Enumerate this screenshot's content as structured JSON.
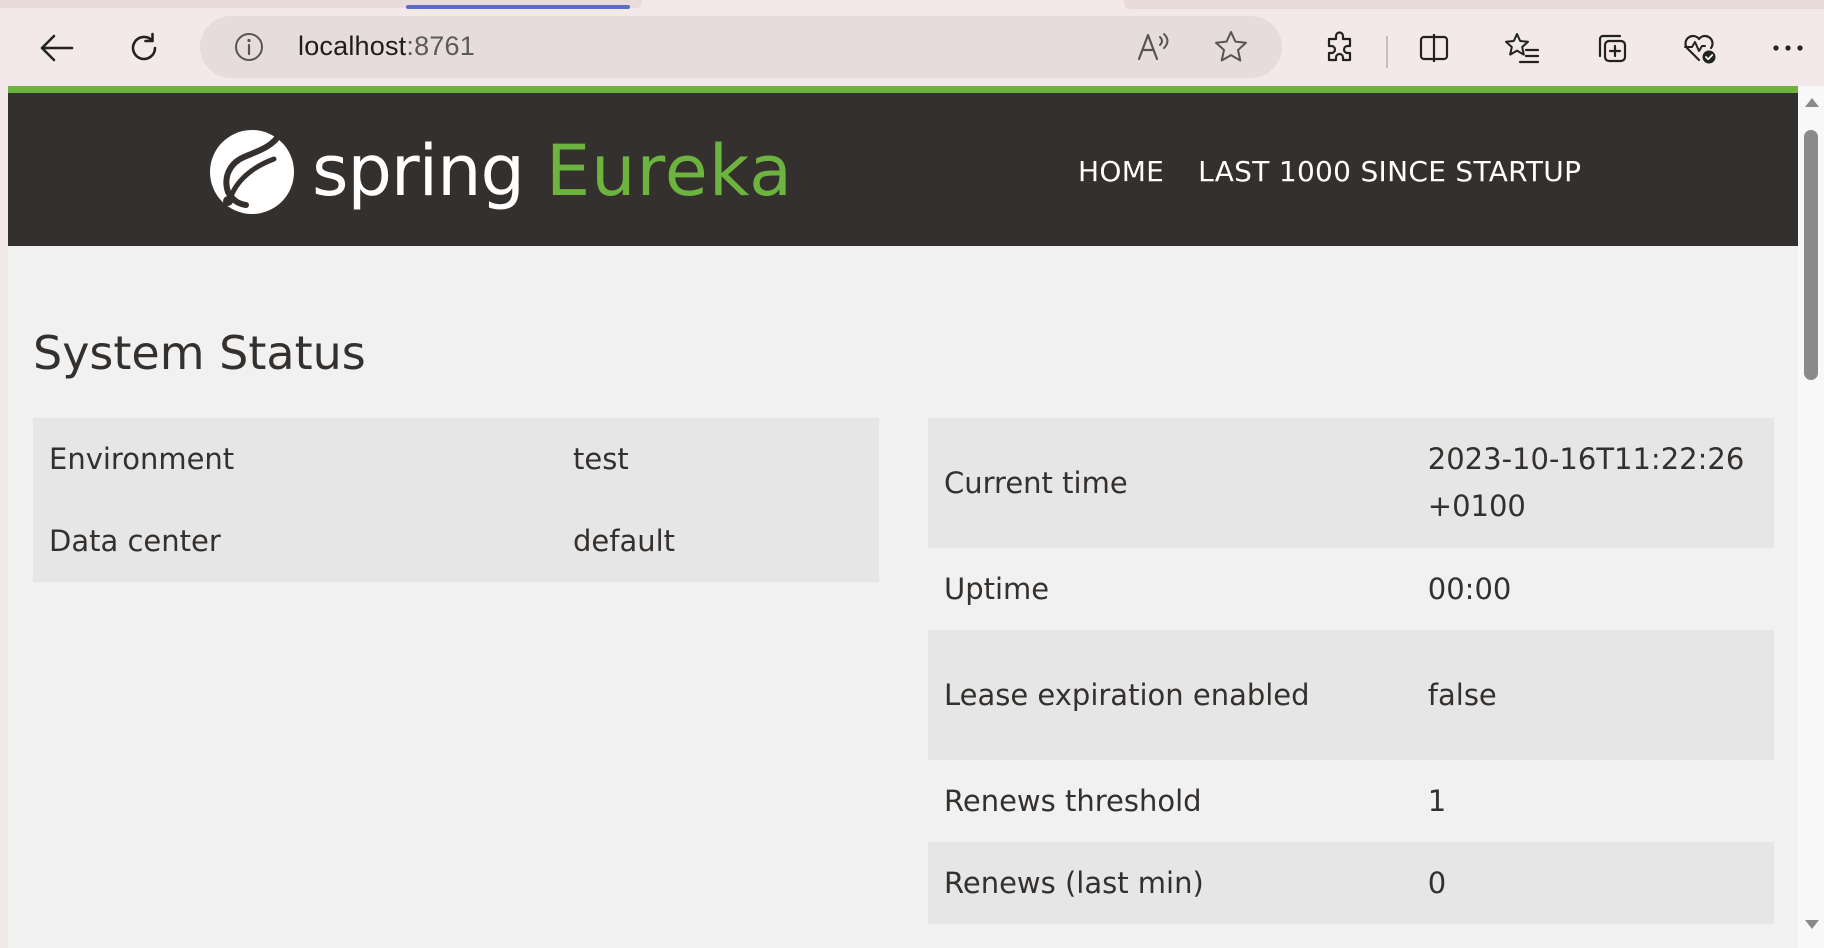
{
  "browser": {
    "address": {
      "host": "localhost",
      "port": ":8761"
    },
    "icons": {
      "back": "back-arrow-icon",
      "refresh": "refresh-icon",
      "site_info": "info-icon",
      "read_aloud": "read-aloud-icon",
      "favorite": "star-icon",
      "extensions": "puzzle-icon",
      "split_screen": "split-screen-icon",
      "favorites": "favorites-list-icon",
      "collections": "collections-icon",
      "health": "heart-pulse-icon",
      "more": "more-dots-icon"
    },
    "colors": {
      "frame": "#f3e9e8",
      "active_tab_indicator": "#5b6dc7"
    }
  },
  "header": {
    "logo_spring": "spring",
    "logo_eureka": "Eureka",
    "nav": [
      {
        "label": "HOME"
      },
      {
        "label": "LAST 1000 SINCE STARTUP"
      }
    ],
    "colors": {
      "navbar": "#34302d",
      "accent": "#6db33f"
    }
  },
  "main": {
    "title": "System Status",
    "left_table": [
      {
        "key": "Environment",
        "value": "test"
      },
      {
        "key": "Data center",
        "value": "default"
      }
    ],
    "right_table": [
      {
        "key": "Current time",
        "value": "2023-10-16T11:22:26 +0100"
      },
      {
        "key": "Uptime",
        "value": "00:00"
      },
      {
        "key": "Lease expiration enabled",
        "value": "false"
      },
      {
        "key": "Renews threshold",
        "value": "1"
      },
      {
        "key": "Renews (last min)",
        "value": "0"
      }
    ]
  }
}
